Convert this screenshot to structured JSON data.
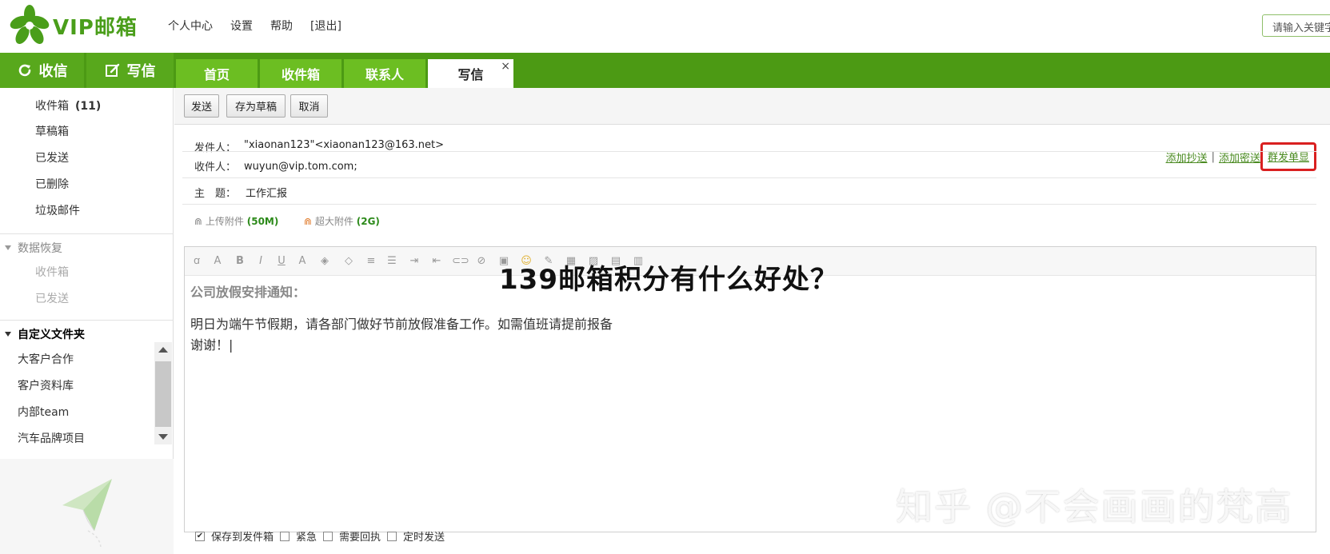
{
  "brand": {
    "logo_text": "VIP邮箱"
  },
  "topnav": [
    "个人中心",
    "设置",
    "帮助",
    "[退出]"
  ],
  "search": {
    "placeholder": "请输入关键字"
  },
  "quick_buttons": {
    "receive": "收信",
    "write": "写信"
  },
  "tabs": [
    {
      "label": "首页"
    },
    {
      "label": "收件箱"
    },
    {
      "label": "联系人"
    },
    {
      "label": "写信",
      "close": "×"
    }
  ],
  "sidebar": {
    "folders": [
      {
        "label": "收件箱",
        "count": "(11)"
      },
      {
        "label": "草稿箱"
      },
      {
        "label": "已发送"
      },
      {
        "label": "已删除"
      },
      {
        "label": "垃圾邮件"
      }
    ],
    "recovery": {
      "title": "数据恢复",
      "items": [
        "收件箱",
        "已发送"
      ]
    },
    "custom": {
      "title": "自定义文件夹",
      "items": [
        "大客户合作",
        "客户资料库",
        "内部team",
        "汽车品牌项目"
      ]
    }
  },
  "toolbar": {
    "send": "发送",
    "save_draft": "存为草稿",
    "cancel": "取消"
  },
  "compose": {
    "from_label": "发件人：",
    "from_value": "\"xiaonan123\"<xiaonan123@163.net>",
    "to_label": "收件人：",
    "to_value": "wuyun@vip.tom.com;",
    "subject_label": "主　题：",
    "subject_value": "工作汇报",
    "add_cc": "添加抄送",
    "add_bcc": "添加密送",
    "separator": "|",
    "group_single": "群发单显",
    "attach_label": "上传附件",
    "attach_size": "(50M)",
    "big_attach_label": "超大附件",
    "big_attach_size": "(2G)"
  },
  "body": {
    "heading": "公司放假安排通知：",
    "line1": "明日为端午节假期，请各部门做好节前放假准备工作。如需值班请提前报备",
    "line2": "谢谢！|"
  },
  "options": [
    "保存到发件箱",
    "紧急",
    "需要回执",
    "定时发送"
  ],
  "overlay_title": "139邮箱积分有什么好处？",
  "watermark": "知乎 @不会画画的梵高",
  "colors": {
    "brand_green": "#4c9a14",
    "tab_green": "#6cbe22",
    "highlight": "#d92020"
  }
}
